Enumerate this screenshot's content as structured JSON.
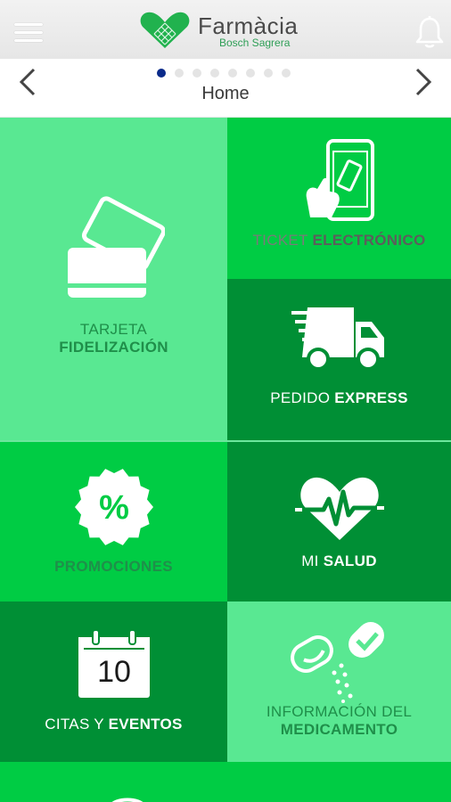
{
  "header": {
    "brand_name": "Farmàcia",
    "brand_subtitle": "Bosch Sagrera",
    "icons": [
      "menu-icon",
      "heart-logo-icon",
      "bell-icon"
    ]
  },
  "nav": {
    "title": "Home",
    "page_dots": 8,
    "active_dot": 1
  },
  "tiles": {
    "tarjeta": {
      "line1": "TARJETA",
      "line2": "FIDELIZACIÓN",
      "icon": "cards-icon"
    },
    "ticket": {
      "light": "TICKET ",
      "bold": "ELECTRÓNICO",
      "icon": "phone-ticket-icon"
    },
    "pedido": {
      "light": "PEDIDO ",
      "bold": "EXPRESS",
      "icon": "truck-icon"
    },
    "promociones": {
      "bold": "PROMOCIONES",
      "icon": "percent-badge-icon"
    },
    "salud": {
      "light": "MI ",
      "bold": "SALUD",
      "icon": "heart-pulse-icon"
    },
    "citas": {
      "light": "CITAS Y ",
      "bold": "EVENTOS",
      "day": "10",
      "icon": "calendar-icon"
    },
    "medicamento": {
      "line1": "INFORMACIÓN DEL",
      "line2": "MEDICAMENTO",
      "icon": "pills-icon"
    }
  },
  "colors": {
    "tile_light": "#59e892",
    "tile_mid": "#00cc44",
    "tile_dark": "#008f35",
    "label_on_light": "#1f8f4a",
    "active_dot": "#0a2a8a"
  }
}
